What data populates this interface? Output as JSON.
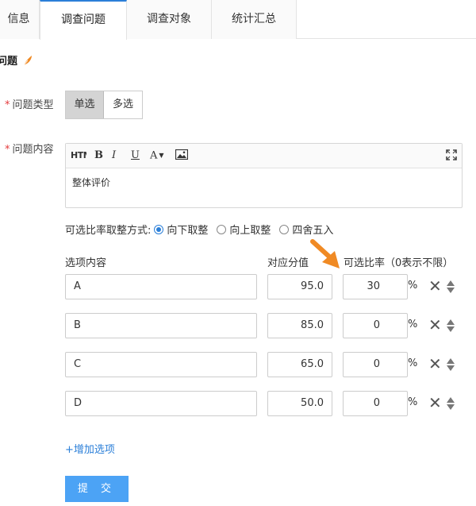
{
  "tabs": [
    {
      "label": "信息"
    },
    {
      "label": "调查问题"
    },
    {
      "label": "调查对象"
    },
    {
      "label": "统计汇总"
    }
  ],
  "active_tab": 1,
  "section_title": "问题",
  "form": {
    "required_mark": "*",
    "type_label": "问题类型",
    "type_options": [
      {
        "label": "单选",
        "selected": true
      },
      {
        "label": "多选",
        "selected": false
      }
    ],
    "content_label": "问题内容",
    "editor": {
      "toolbar": {
        "html": "HTML",
        "bold": "B",
        "italic": "I",
        "underline": "U",
        "font": "A"
      },
      "text": "整体评价"
    },
    "rounding": {
      "label": "可选比率取整方式:",
      "options": [
        {
          "label": "向下取整",
          "selected": true
        },
        {
          "label": "向上取整",
          "selected": false
        },
        {
          "label": "四舍五入",
          "selected": false
        }
      ]
    },
    "columns": {
      "option": "选项内容",
      "score": "对应分值",
      "rate": "可选比率（0表示不限）"
    },
    "options": [
      {
        "content": "A",
        "score": "95.0",
        "rate": "30",
        "unit": "%"
      },
      {
        "content": "B",
        "score": "85.0",
        "rate": "0",
        "unit": "%"
      },
      {
        "content": "C",
        "score": "65.0",
        "rate": "0",
        "unit": "%"
      },
      {
        "content": "D",
        "score": "50.0",
        "rate": "0",
        "unit": "%"
      }
    ],
    "add_option": "+增加选项",
    "submit": "提 交"
  },
  "colors": {
    "accent": "#2b7fd8",
    "submit_bg": "#4ca3f5",
    "required": "#e4393c",
    "annotation_arrow": "#f08a24"
  },
  "icons": {
    "section": "feather-icon",
    "image": "image-icon",
    "fullscreen": "fullscreen-icon",
    "delete": "close-icon",
    "sort": "sort-icon"
  }
}
